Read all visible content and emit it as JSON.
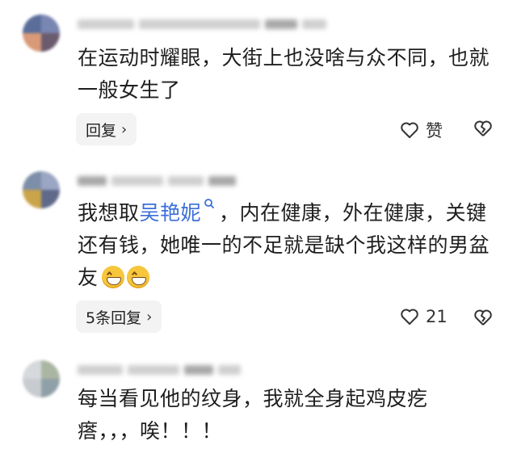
{
  "comments": [
    {
      "text": "在运动时耀眼，大街上也没啥与众不同，也就一般女生了",
      "reply_label": "回复",
      "like_label": "赞",
      "icons": [
        "heart-outline-icon",
        "broken-heart-icon",
        "chevron-right-icon"
      ]
    },
    {
      "text_before": "我想取",
      "mention": "吴艳妮",
      "text_after": "，内在健康，外在健康，关键还有钱，她唯一的不足就是缺个我这样的男盆友",
      "emoji": [
        "grin-emoji",
        "grin-emoji"
      ],
      "reply_label": "5条回复",
      "like_count": "21",
      "mention_color": "#3b6fd8"
    },
    {
      "text": "每当看见他的纹身，我就全身起鸡皮疙瘩，，，唉！！！"
    }
  ]
}
